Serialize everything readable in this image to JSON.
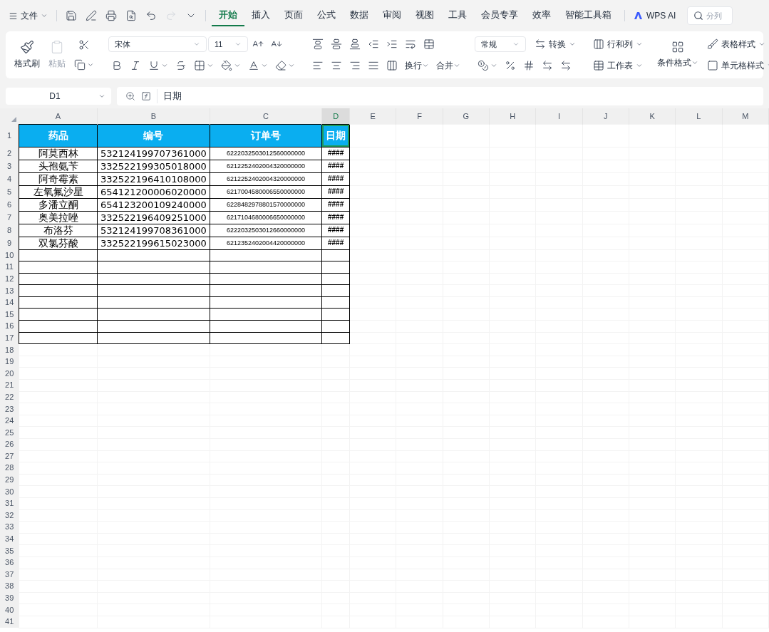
{
  "menu": {
    "label": "文件"
  },
  "tabs": [
    {
      "label": "开始",
      "selected": true
    },
    {
      "label": "插入",
      "selected": false
    },
    {
      "label": "页面",
      "selected": false
    },
    {
      "label": "公式",
      "selected": false
    },
    {
      "label": "数据",
      "selected": false
    },
    {
      "label": "审阅",
      "selected": false
    },
    {
      "label": "视图",
      "selected": false
    },
    {
      "label": "工具",
      "selected": false
    },
    {
      "label": "会员专享",
      "selected": false
    },
    {
      "label": "效率",
      "selected": false
    },
    {
      "label": "智能工具箱",
      "selected": false
    }
  ],
  "ai_button": {
    "label": "WPS AI"
  },
  "search": {
    "placeholder": "分列"
  },
  "ribbon": {
    "format_painter": "格式刷",
    "paste": {
      "label": "粘贴",
      "disabled": true
    },
    "font_name": "宋体",
    "font_size": "11",
    "wrap": "换行",
    "merge": "合并",
    "number_format": "常规",
    "convert": "转换",
    "rows_cols": "行和列",
    "worksheet": "工作表",
    "conditional": "条件格式",
    "table_style": "表格样式",
    "cell_style": "单元格样式"
  },
  "formula_bar": {
    "cell_ref": "D1",
    "value": "日期"
  },
  "sheet": {
    "columns": [
      {
        "label": "A",
        "selected": false
      },
      {
        "label": "B",
        "selected": false
      },
      {
        "label": "C",
        "selected": false
      },
      {
        "label": "D",
        "selected": true
      },
      {
        "label": "E",
        "selected": false
      },
      {
        "label": "F",
        "selected": false
      },
      {
        "label": "G",
        "selected": false
      },
      {
        "label": "H",
        "selected": false
      },
      {
        "label": "I",
        "selected": false
      },
      {
        "label": "J",
        "selected": false
      },
      {
        "label": "K",
        "selected": false
      },
      {
        "label": "L",
        "selected": false
      },
      {
        "label": "M",
        "selected": false
      }
    ],
    "rows": [
      {
        "header": "1",
        "bordered": true,
        "kind": "header",
        "cells": [
          {
            "text": "药品",
            "selected": false
          },
          {
            "text": "编号",
            "selected": false
          },
          {
            "text": "订单号",
            "selected": false
          },
          {
            "text": "日期",
            "selected": true
          }
        ]
      },
      {
        "header": "2",
        "bordered": true,
        "kind": "data",
        "cells": [
          "阿莫西林",
          "532124199707361000",
          "6222032503012560000000",
          "####"
        ]
      },
      {
        "header": "3",
        "bordered": true,
        "kind": "data",
        "cells": [
          "头孢氨苄",
          "332522199305018000",
          "6212252402004320000000",
          "####"
        ]
      },
      {
        "header": "4",
        "bordered": true,
        "kind": "data",
        "cells": [
          "阿奇霉素",
          "332522196410108000",
          "6212252402004320000000",
          "####"
        ]
      },
      {
        "header": "5",
        "bordered": true,
        "kind": "data",
        "cells": [
          "左氧氟沙星",
          "654121200006020000",
          "6217004580006550000000",
          "####"
        ]
      },
      {
        "header": "6",
        "bordered": true,
        "kind": "data",
        "cells": [
          "多潘立酮",
          "654123200109240000",
          "6228482978801570000000",
          "####"
        ]
      },
      {
        "header": "7",
        "bordered": true,
        "kind": "data",
        "cells": [
          "奥美拉唑",
          "332522196409251000",
          "6217104680006650000000",
          "####"
        ]
      },
      {
        "header": "8",
        "bordered": true,
        "kind": "data",
        "cells": [
          "布洛芬",
          "532124199708361000",
          "6222032503012660000000",
          "####"
        ]
      },
      {
        "header": "9",
        "bordered": true,
        "kind": "data",
        "cells": [
          "双氯芬酸",
          "332522199615023000",
          "6212352402004420000000",
          "####"
        ]
      },
      {
        "header": "10",
        "bordered": true,
        "kind": "blank"
      },
      {
        "header": "11",
        "bordered": true,
        "kind": "blank"
      },
      {
        "header": "12",
        "bordered": true,
        "kind": "blank"
      },
      {
        "header": "13",
        "bordered": true,
        "kind": "blank"
      },
      {
        "header": "14",
        "bordered": true,
        "kind": "blank"
      },
      {
        "header": "15",
        "bordered": true,
        "kind": "blank"
      },
      {
        "header": "16",
        "bordered": true,
        "kind": "blank"
      },
      {
        "header": "17",
        "bordered": true,
        "kind": "blank"
      },
      {
        "header": "18",
        "bordered": false,
        "kind": "blank"
      },
      {
        "header": "19",
        "bordered": false,
        "kind": "blank"
      },
      {
        "header": "20",
        "bordered": false,
        "kind": "blank"
      },
      {
        "header": "21",
        "bordered": false,
        "kind": "blank"
      },
      {
        "header": "22",
        "bordered": false,
        "kind": "blank"
      },
      {
        "header": "23",
        "bordered": false,
        "kind": "blank"
      },
      {
        "header": "24",
        "bordered": false,
        "kind": "blank"
      },
      {
        "header": "25",
        "bordered": false,
        "kind": "blank"
      },
      {
        "header": "26",
        "bordered": false,
        "kind": "blank"
      },
      {
        "header": "27",
        "bordered": false,
        "kind": "blank"
      },
      {
        "header": "28",
        "bordered": false,
        "kind": "blank"
      },
      {
        "header": "29",
        "bordered": false,
        "kind": "blank"
      },
      {
        "header": "30",
        "bordered": false,
        "kind": "blank"
      },
      {
        "header": "31",
        "bordered": false,
        "kind": "blank"
      },
      {
        "header": "32",
        "bordered": false,
        "kind": "blank"
      },
      {
        "header": "33",
        "bordered": false,
        "kind": "blank"
      },
      {
        "header": "34",
        "bordered": false,
        "kind": "blank"
      },
      {
        "header": "35",
        "bordered": false,
        "kind": "blank"
      },
      {
        "header": "36",
        "bordered": false,
        "kind": "blank"
      },
      {
        "header": "37",
        "bordered": false,
        "kind": "blank"
      },
      {
        "header": "38",
        "bordered": false,
        "kind": "blank"
      },
      {
        "header": "39",
        "bordered": false,
        "kind": "blank"
      },
      {
        "header": "40",
        "bordered": false,
        "kind": "blank"
      },
      {
        "header": "41",
        "bordered": false,
        "kind": "blank"
      }
    ]
  }
}
